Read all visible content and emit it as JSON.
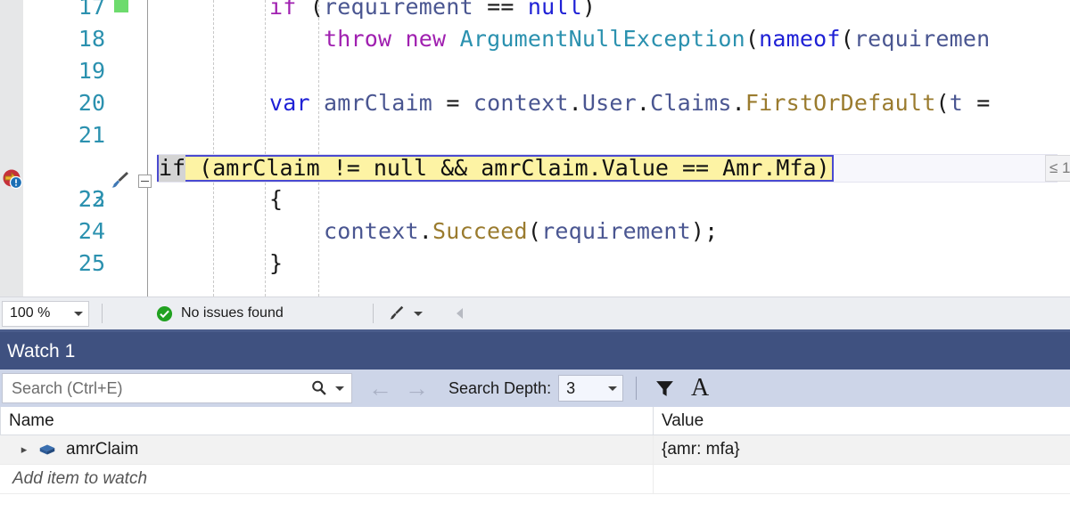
{
  "editor": {
    "lines": [
      {
        "number": "17",
        "tokens": [
          {
            "t": "        ",
            "c": "t-plain"
          },
          {
            "t": "if",
            "c": "t-kw"
          },
          {
            "t": " (",
            "c": "t-punc"
          },
          {
            "t": "requirement",
            "c": "t-ident"
          },
          {
            "t": " == ",
            "c": "t-punc"
          },
          {
            "t": "null",
            "c": "t-blue"
          },
          {
            "t": ")",
            "c": "t-punc"
          }
        ]
      },
      {
        "number": "18",
        "tokens": [
          {
            "t": "            ",
            "c": "t-plain"
          },
          {
            "t": "throw",
            "c": "t-kw"
          },
          {
            "t": " ",
            "c": "t-punc"
          },
          {
            "t": "new",
            "c": "t-kw"
          },
          {
            "t": " ",
            "c": "t-punc"
          },
          {
            "t": "ArgumentNullException",
            "c": "t-type"
          },
          {
            "t": "(",
            "c": "t-punc"
          },
          {
            "t": "nameof",
            "c": "t-blue"
          },
          {
            "t": "(",
            "c": "t-punc"
          },
          {
            "t": "requiremen",
            "c": "t-ident"
          }
        ]
      },
      {
        "number": "19",
        "tokens": []
      },
      {
        "number": "20",
        "tokens": [
          {
            "t": "        ",
            "c": "t-plain"
          },
          {
            "t": "var",
            "c": "t-blue"
          },
          {
            "t": " ",
            "c": "t-punc"
          },
          {
            "t": "amrClaim",
            "c": "t-ident"
          },
          {
            "t": " = ",
            "c": "t-punc"
          },
          {
            "t": "context",
            "c": "t-ident"
          },
          {
            "t": ".",
            "c": "t-punc"
          },
          {
            "t": "User",
            "c": "t-ident"
          },
          {
            "t": ".",
            "c": "t-punc"
          },
          {
            "t": "Claims",
            "c": "t-ident"
          },
          {
            "t": ".",
            "c": "t-punc"
          },
          {
            "t": "FirstOrDefault",
            "c": "t-method"
          },
          {
            "t": "(",
            "c": "t-punc"
          },
          {
            "t": "t",
            "c": "t-ident"
          },
          {
            "t": " =",
            "c": "t-punc"
          }
        ]
      },
      {
        "number": "21",
        "tokens": []
      },
      {
        "number": "22",
        "tokens": []
      },
      {
        "number": "23",
        "tokens": [
          {
            "t": "        {",
            "c": "t-punc"
          }
        ]
      },
      {
        "number": "24",
        "tokens": [
          {
            "t": "            ",
            "c": "t-plain"
          },
          {
            "t": "context",
            "c": "t-ident"
          },
          {
            "t": ".",
            "c": "t-punc"
          },
          {
            "t": "Succeed",
            "c": "t-method"
          },
          {
            "t": "(",
            "c": "t-punc"
          },
          {
            "t": "requirement",
            "c": "t-ident"
          },
          {
            "t": ");",
            "c": "t-punc"
          }
        ]
      },
      {
        "number": "25",
        "tokens": [
          {
            "t": "        }",
            "c": "t-punc"
          }
        ]
      }
    ],
    "current_line": {
      "number": "22",
      "selected_text": "if",
      "rest_text": " (amrClaim != null && amrClaim.Value == Amr.Mfa)",
      "perf_tip": "≤ 1",
      "highlight_bg": "#fdf3a4",
      "highlight_border": "#4a4ad0"
    },
    "breakpoint_icon": "conditional-breakpoint-icon",
    "brush_icon": "code-cleanup-brush-icon",
    "change_marker_color": "#6ddb6d",
    "line_number_color": "#2b91af"
  },
  "status_bar": {
    "zoom_level": "100 %",
    "issues_icon": "check-circle-icon",
    "issues_text": "No issues found",
    "cleanup_icon": "code-cleanup-icon",
    "collapse_icon": "chevron-left-icon"
  },
  "watch": {
    "title": "Watch 1",
    "search": {
      "placeholder": "Search (Ctrl+E)",
      "icon": "magnifier-icon",
      "dropdown_icon": "chevron-down-icon"
    },
    "prev_icon": "arrow-left-icon",
    "next_icon": "arrow-right-icon",
    "depth_label": "Search Depth:",
    "depth_value": "3",
    "filter_icon": "funnel-filter-icon",
    "alpha_icon": "A",
    "columns": [
      "Name",
      "Value"
    ],
    "rows": [
      {
        "expander": "▸",
        "icon": "object-box-icon",
        "name": "amrClaim",
        "value": "{amr: mfa}"
      }
    ],
    "add_item_text": "Add item to watch",
    "titlebar_color": "#3f5180",
    "toolbar_color": "#cdd5e8"
  }
}
